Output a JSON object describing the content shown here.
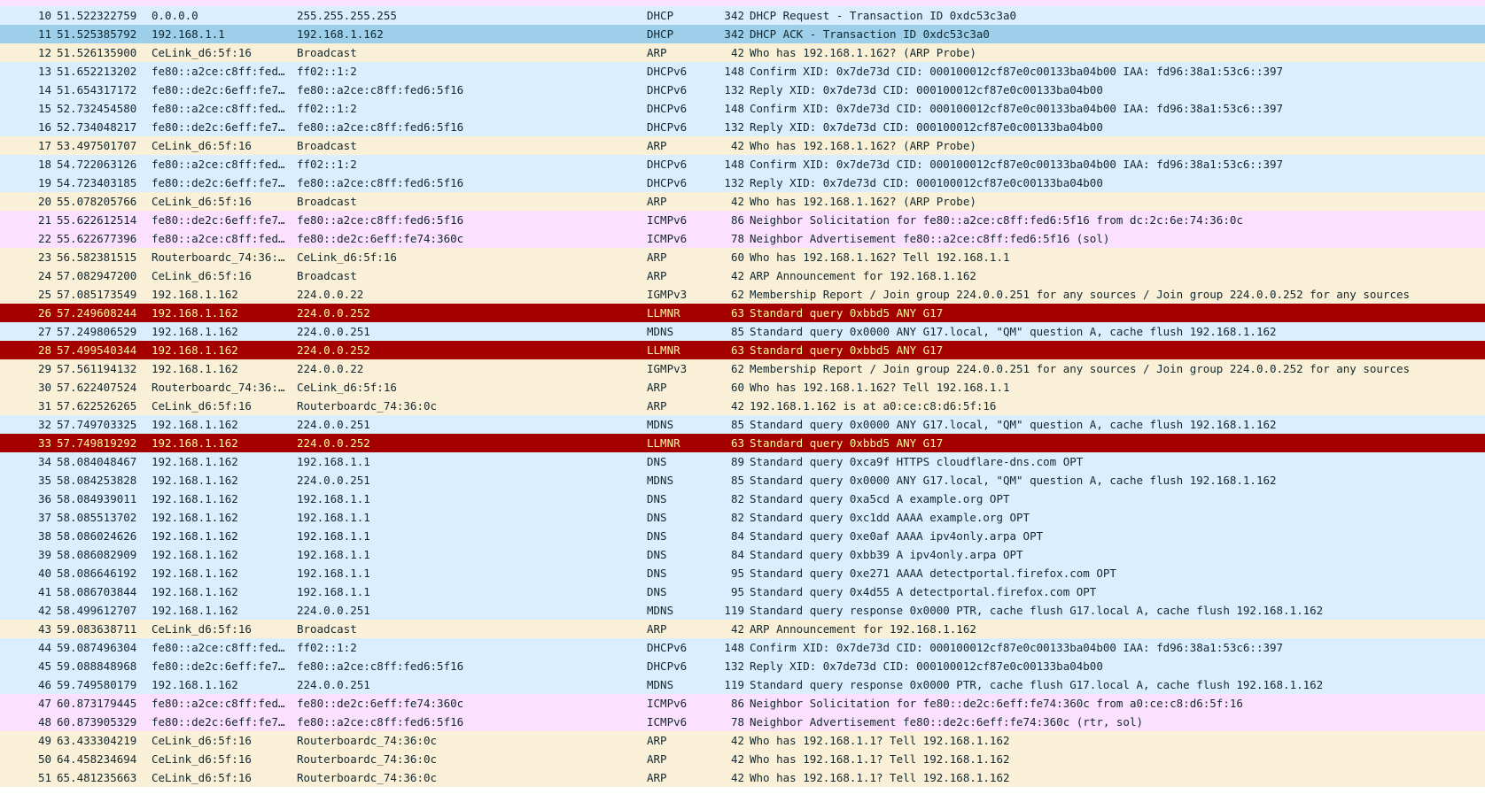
{
  "packet_list": {
    "partial_top_row_color": "#fce0ff",
    "rows": [
      {
        "no": "10",
        "time": "51.522322759",
        "source": "0.0.0.0",
        "destination": "255.255.255.255",
        "protocol": "DHCP",
        "length": "342",
        "info": "DHCP Request  - Transaction ID 0xdc53c3a0",
        "color_rule": "dhcp",
        "selected": false
      },
      {
        "no": "11",
        "time": "51.525385792",
        "source": "192.168.1.1",
        "destination": "192.168.1.162",
        "protocol": "DHCP",
        "length": "342",
        "info": "DHCP ACK      - Transaction ID 0xdc53c3a0",
        "color_rule": "dhcp",
        "selected": true
      },
      {
        "no": "12",
        "time": "51.526135900",
        "source": "CeLink_d6:5f:16",
        "destination": "Broadcast",
        "protocol": "ARP",
        "length": "42",
        "info": "Who has 192.168.1.162? (ARP Probe)",
        "color_rule": "arp",
        "selected": false
      },
      {
        "no": "13",
        "time": "51.652213202",
        "source": "fe80::a2ce:c8ff:fed…",
        "destination": "ff02::1:2",
        "protocol": "DHCPv6",
        "length": "148",
        "info": "Confirm XID: 0x7de73d CID: 000100012cf87e0c00133ba04b00 IAA: fd96:38a1:53c6::397",
        "color_rule": "dhcp",
        "selected": false
      },
      {
        "no": "14",
        "time": "51.654317172",
        "source": "fe80::de2c:6eff:fe7…",
        "destination": "fe80::a2ce:c8ff:fed6:5f16",
        "protocol": "DHCPv6",
        "length": "132",
        "info": "Reply XID: 0x7de73d CID: 000100012cf87e0c00133ba04b00",
        "color_rule": "dhcp",
        "selected": false
      },
      {
        "no": "15",
        "time": "52.732454580",
        "source": "fe80::a2ce:c8ff:fed…",
        "destination": "ff02::1:2",
        "protocol": "DHCPv6",
        "length": "148",
        "info": "Confirm XID: 0x7de73d CID: 000100012cf87e0c00133ba04b00 IAA: fd96:38a1:53c6::397",
        "color_rule": "dhcp",
        "selected": false
      },
      {
        "no": "16",
        "time": "52.734048217",
        "source": "fe80::de2c:6eff:fe7…",
        "destination": "fe80::a2ce:c8ff:fed6:5f16",
        "protocol": "DHCPv6",
        "length": "132",
        "info": "Reply XID: 0x7de73d CID: 000100012cf87e0c00133ba04b00",
        "color_rule": "dhcp",
        "selected": false
      },
      {
        "no": "17",
        "time": "53.497501707",
        "source": "CeLink_d6:5f:16",
        "destination": "Broadcast",
        "protocol": "ARP",
        "length": "42",
        "info": "Who has 192.168.1.162? (ARP Probe)",
        "color_rule": "arp",
        "selected": false
      },
      {
        "no": "18",
        "time": "54.722063126",
        "source": "fe80::a2ce:c8ff:fed…",
        "destination": "ff02::1:2",
        "protocol": "DHCPv6",
        "length": "148",
        "info": "Confirm XID: 0x7de73d CID: 000100012cf87e0c00133ba04b00 IAA: fd96:38a1:53c6::397",
        "color_rule": "dhcp",
        "selected": false
      },
      {
        "no": "19",
        "time": "54.723403185",
        "source": "fe80::de2c:6eff:fe7…",
        "destination": "fe80::a2ce:c8ff:fed6:5f16",
        "protocol": "DHCPv6",
        "length": "132",
        "info": "Reply XID: 0x7de73d CID: 000100012cf87e0c00133ba04b00",
        "color_rule": "dhcp",
        "selected": false
      },
      {
        "no": "20",
        "time": "55.078205766",
        "source": "CeLink_d6:5f:16",
        "destination": "Broadcast",
        "protocol": "ARP",
        "length": "42",
        "info": "Who has 192.168.1.162? (ARP Probe)",
        "color_rule": "arp",
        "selected": false
      },
      {
        "no": "21",
        "time": "55.622612514",
        "source": "fe80::de2c:6eff:fe7…",
        "destination": "fe80::a2ce:c8ff:fed6:5f16",
        "protocol": "ICMPv6",
        "length": "86",
        "info": "Neighbor Solicitation for fe80::a2ce:c8ff:fed6:5f16 from dc:2c:6e:74:36:0c",
        "color_rule": "icmpv6",
        "selected": false
      },
      {
        "no": "22",
        "time": "55.622677396",
        "source": "fe80::a2ce:c8ff:fed…",
        "destination": "fe80::de2c:6eff:fe74:360c",
        "protocol": "ICMPv6",
        "length": "78",
        "info": "Neighbor Advertisement fe80::a2ce:c8ff:fed6:5f16 (sol)",
        "color_rule": "icmpv6",
        "selected": false
      },
      {
        "no": "23",
        "time": "56.582381515",
        "source": "Routerboardc_74:36:…",
        "destination": "CeLink_d6:5f:16",
        "protocol": "ARP",
        "length": "60",
        "info": "Who has 192.168.1.162? Tell 192.168.1.1",
        "color_rule": "arp",
        "selected": false
      },
      {
        "no": "24",
        "time": "57.082947200",
        "source": "CeLink_d6:5f:16",
        "destination": "Broadcast",
        "protocol": "ARP",
        "length": "42",
        "info": "ARP Announcement for 192.168.1.162",
        "color_rule": "arp",
        "selected": false
      },
      {
        "no": "25",
        "time": "57.085173549",
        "source": "192.168.1.162",
        "destination": "224.0.0.22",
        "protocol": "IGMPv3",
        "length": "62",
        "info": "Membership Report / Join group 224.0.0.251 for any sources / Join group 224.0.0.252 for any sources",
        "color_rule": "arp",
        "selected": false
      },
      {
        "no": "26",
        "time": "57.249608244",
        "source": "192.168.1.162",
        "destination": "224.0.0.252",
        "protocol": "LLMNR",
        "length": "63",
        "info": "Standard query 0xbbd5 ANY G17",
        "color_rule": "llmnr",
        "selected": false
      },
      {
        "no": "27",
        "time": "57.249806529",
        "source": "192.168.1.162",
        "destination": "224.0.0.251",
        "protocol": "MDNS",
        "length": "85",
        "info": "Standard query 0x0000 ANY G17.local, \"QM\" question A, cache flush 192.168.1.162",
        "color_rule": "dhcp",
        "selected": false
      },
      {
        "no": "28",
        "time": "57.499540344",
        "source": "192.168.1.162",
        "destination": "224.0.0.252",
        "protocol": "LLMNR",
        "length": "63",
        "info": "Standard query 0xbbd5 ANY G17",
        "color_rule": "llmnr",
        "selected": false
      },
      {
        "no": "29",
        "time": "57.561194132",
        "source": "192.168.1.162",
        "destination": "224.0.0.22",
        "protocol": "IGMPv3",
        "length": "62",
        "info": "Membership Report / Join group 224.0.0.251 for any sources / Join group 224.0.0.252 for any sources",
        "color_rule": "arp",
        "selected": false
      },
      {
        "no": "30",
        "time": "57.622407524",
        "source": "Routerboardc_74:36:…",
        "destination": "CeLink_d6:5f:16",
        "protocol": "ARP",
        "length": "60",
        "info": "Who has 192.168.1.162? Tell 192.168.1.1",
        "color_rule": "arp",
        "selected": false
      },
      {
        "no": "31",
        "time": "57.622526265",
        "source": "CeLink_d6:5f:16",
        "destination": "Routerboardc_74:36:0c",
        "protocol": "ARP",
        "length": "42",
        "info": "192.168.1.162 is at a0:ce:c8:d6:5f:16",
        "color_rule": "arp",
        "selected": false
      },
      {
        "no": "32",
        "time": "57.749703325",
        "source": "192.168.1.162",
        "destination": "224.0.0.251",
        "protocol": "MDNS",
        "length": "85",
        "info": "Standard query 0x0000 ANY G17.local, \"QM\" question A, cache flush 192.168.1.162",
        "color_rule": "dhcp",
        "selected": false
      },
      {
        "no": "33",
        "time": "57.749819292",
        "source": "192.168.1.162",
        "destination": "224.0.0.252",
        "protocol": "LLMNR",
        "length": "63",
        "info": "Standard query 0xbbd5 ANY G17",
        "color_rule": "llmnr",
        "selected": false
      },
      {
        "no": "34",
        "time": "58.084048467",
        "source": "192.168.1.162",
        "destination": "192.168.1.1",
        "protocol": "DNS",
        "length": "89",
        "info": "Standard query 0xca9f HTTPS cloudflare-dns.com OPT",
        "color_rule": "dhcp",
        "selected": false
      },
      {
        "no": "35",
        "time": "58.084253828",
        "source": "192.168.1.162",
        "destination": "224.0.0.251",
        "protocol": "MDNS",
        "length": "85",
        "info": "Standard query 0x0000 ANY G17.local, \"QM\" question A, cache flush 192.168.1.162",
        "color_rule": "dhcp",
        "selected": false
      },
      {
        "no": "36",
        "time": "58.084939011",
        "source": "192.168.1.162",
        "destination": "192.168.1.1",
        "protocol": "DNS",
        "length": "82",
        "info": "Standard query 0xa5cd A example.org OPT",
        "color_rule": "dhcp",
        "selected": false
      },
      {
        "no": "37",
        "time": "58.085513702",
        "source": "192.168.1.162",
        "destination": "192.168.1.1",
        "protocol": "DNS",
        "length": "82",
        "info": "Standard query 0xc1dd AAAA example.org OPT",
        "color_rule": "dhcp",
        "selected": false
      },
      {
        "no": "38",
        "time": "58.086024626",
        "source": "192.168.1.162",
        "destination": "192.168.1.1",
        "protocol": "DNS",
        "length": "84",
        "info": "Standard query 0xe0af AAAA ipv4only.arpa OPT",
        "color_rule": "dhcp",
        "selected": false
      },
      {
        "no": "39",
        "time": "58.086082909",
        "source": "192.168.1.162",
        "destination": "192.168.1.1",
        "protocol": "DNS",
        "length": "84",
        "info": "Standard query 0xbb39 A ipv4only.arpa OPT",
        "color_rule": "dhcp",
        "selected": false
      },
      {
        "no": "40",
        "time": "58.086646192",
        "source": "192.168.1.162",
        "destination": "192.168.1.1",
        "protocol": "DNS",
        "length": "95",
        "info": "Standard query 0xe271 AAAA detectportal.firefox.com OPT",
        "color_rule": "dhcp",
        "selected": false
      },
      {
        "no": "41",
        "time": "58.086703844",
        "source": "192.168.1.162",
        "destination": "192.168.1.1",
        "protocol": "DNS",
        "length": "95",
        "info": "Standard query 0x4d55 A detectportal.firefox.com OPT",
        "color_rule": "dhcp",
        "selected": false
      },
      {
        "no": "42",
        "time": "58.499612707",
        "source": "192.168.1.162",
        "destination": "224.0.0.251",
        "protocol": "MDNS",
        "length": "119",
        "info": "Standard query response 0x0000 PTR, cache flush G17.local A, cache flush 192.168.1.162",
        "color_rule": "dhcp",
        "selected": false
      },
      {
        "no": "43",
        "time": "59.083638711",
        "source": "CeLink_d6:5f:16",
        "destination": "Broadcast",
        "protocol": "ARP",
        "length": "42",
        "info": "ARP Announcement for 192.168.1.162",
        "color_rule": "arp",
        "selected": false
      },
      {
        "no": "44",
        "time": "59.087496304",
        "source": "fe80::a2ce:c8ff:fed…",
        "destination": "ff02::1:2",
        "protocol": "DHCPv6",
        "length": "148",
        "info": "Confirm XID: 0x7de73d CID: 000100012cf87e0c00133ba04b00 IAA: fd96:38a1:53c6::397",
        "color_rule": "dhcp",
        "selected": false
      },
      {
        "no": "45",
        "time": "59.088848968",
        "source": "fe80::de2c:6eff:fe7…",
        "destination": "fe80::a2ce:c8ff:fed6:5f16",
        "protocol": "DHCPv6",
        "length": "132",
        "info": "Reply XID: 0x7de73d CID: 000100012cf87e0c00133ba04b00",
        "color_rule": "dhcp",
        "selected": false
      },
      {
        "no": "46",
        "time": "59.749580179",
        "source": "192.168.1.162",
        "destination": "224.0.0.251",
        "protocol": "MDNS",
        "length": "119",
        "info": "Standard query response 0x0000 PTR, cache flush G17.local A, cache flush 192.168.1.162",
        "color_rule": "dhcp",
        "selected": false
      },
      {
        "no": "47",
        "time": "60.873179445",
        "source": "fe80::a2ce:c8ff:fed…",
        "destination": "fe80::de2c:6eff:fe74:360c",
        "protocol": "ICMPv6",
        "length": "86",
        "info": "Neighbor Solicitation for fe80::de2c:6eff:fe74:360c from a0:ce:c8:d6:5f:16",
        "color_rule": "icmpv6",
        "selected": false
      },
      {
        "no": "48",
        "time": "60.873905329",
        "source": "fe80::de2c:6eff:fe7…",
        "destination": "fe80::a2ce:c8ff:fed6:5f16",
        "protocol": "ICMPv6",
        "length": "78",
        "info": "Neighbor Advertisement fe80::de2c:6eff:fe74:360c (rtr, sol)",
        "color_rule": "icmpv6",
        "selected": false
      },
      {
        "no": "49",
        "time": "63.433304219",
        "source": "CeLink_d6:5f:16",
        "destination": "Routerboardc_74:36:0c",
        "protocol": "ARP",
        "length": "42",
        "info": "Who has 192.168.1.1? Tell 192.168.1.162",
        "color_rule": "arp",
        "selected": false
      },
      {
        "no": "50",
        "time": "64.458234694",
        "source": "CeLink_d6:5f:16",
        "destination": "Routerboardc_74:36:0c",
        "protocol": "ARP",
        "length": "42",
        "info": "Who has 192.168.1.1? Tell 192.168.1.162",
        "color_rule": "arp",
        "selected": false
      },
      {
        "no": "51",
        "time": "65.481235663",
        "source": "CeLink_d6:5f:16",
        "destination": "Routerboardc_74:36:0c",
        "protocol": "ARP",
        "length": "42",
        "info": "Who has 192.168.1.1? Tell 192.168.1.162",
        "color_rule": "arp",
        "selected": false
      }
    ]
  },
  "colors": {
    "dhcp": "#daeeff",
    "arp": "#faf0d7",
    "icmpv6": "#fce0ff",
    "llmnr_bg": "#a40000",
    "llmnr_fg": "#fffc9c",
    "selected": "#9dcfea",
    "text": "#12272e"
  }
}
